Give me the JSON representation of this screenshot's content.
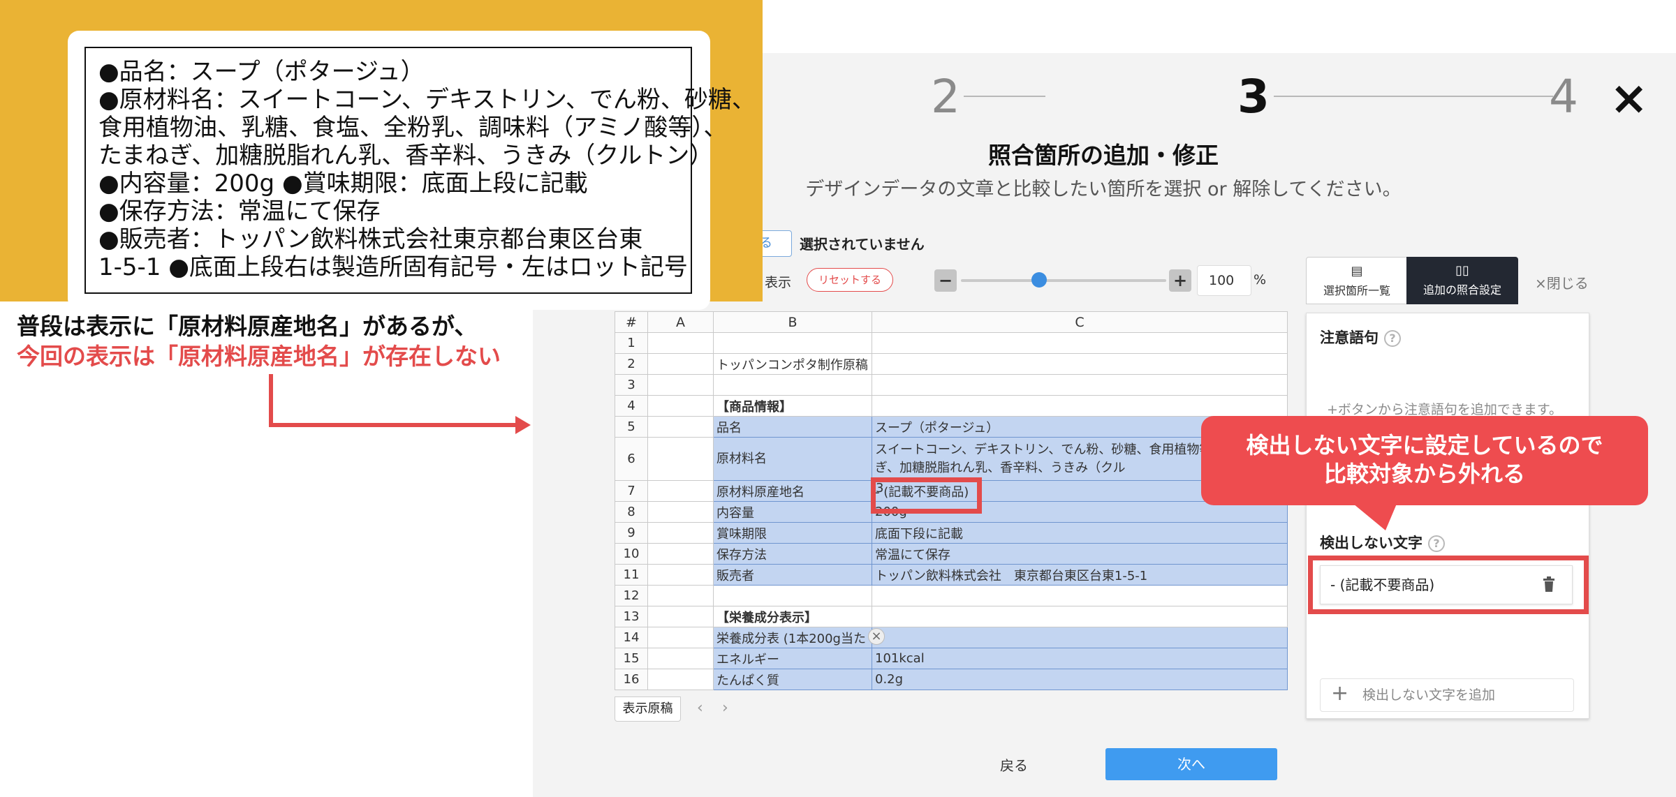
{
  "stepper": {
    "step2": "2",
    "step3": "3",
    "step4": "4",
    "close": "×"
  },
  "modal": {
    "title": "照合箇所の追加・修正",
    "subtitle": "デザインデータの文章と比較したい箇所を選択 or 解除してください。"
  },
  "toolbar": {
    "partial_button": "る",
    "selection_status": "選択されていません",
    "view_label": "表示",
    "reset_button": "リセットする",
    "zoom_minus": "−",
    "zoom_plus": "+",
    "zoom_value": "100",
    "zoom_unit": "%",
    "zoom_level": 0.38
  },
  "sheet": {
    "headers": [
      "#",
      "A",
      "B",
      "C"
    ],
    "rows": [
      {
        "n": "1",
        "b": "",
        "c": ""
      },
      {
        "n": "2",
        "b": "トッパンコンポタ制作原稿",
        "c": ""
      },
      {
        "n": "3",
        "b": "",
        "c": ""
      },
      {
        "n": "4",
        "b": "【商品情報】",
        "c": ""
      },
      {
        "n": "5",
        "b": "品名",
        "c": "スープ（ポタージュ）"
      },
      {
        "n": "6",
        "b": "原材料名",
        "c": "スイートコーン、デキストリン、でん粉、砂糖、食用植物等）、たまねぎ、加糖脱脂れん乳、香辛料、うきみ（クル"
      },
      {
        "n": "7",
        "b": "原材料原産地名",
        "c": "- (記載不要商品)"
      },
      {
        "n": "8",
        "b": "内容量",
        "c": "200g"
      },
      {
        "n": "9",
        "b": "賞味期限",
        "c": "底面下段に記載"
      },
      {
        "n": "10",
        "b": "保存方法",
        "c": "常温にて保存"
      },
      {
        "n": "11",
        "b": "販売者",
        "c": "トッパン飲料株式会社　東京都台東区台東1-5-1"
      },
      {
        "n": "12",
        "b": "",
        "c": ""
      },
      {
        "n": "13",
        "b": "【栄養成分表示】",
        "c": ""
      },
      {
        "n": "14",
        "b": "栄養成分表 (1本200g当た",
        "c": ")"
      },
      {
        "n": "15",
        "b": "エネルギー",
        "c": "101kcal"
      },
      {
        "n": "16",
        "b": "たんぱく質",
        "c": "0.2g"
      }
    ],
    "sheet_tab": "表示原稿",
    "prev": "‹",
    "next": "›",
    "cell_close": "×"
  },
  "panel": {
    "tab_list": "選択箇所一覧",
    "tab_add": "追加の照合設定",
    "close": "×閉じる",
    "caution_title": "注意語句",
    "help": "?",
    "caution_hint": "+ボタンから注意語句を追加できます。",
    "exclude_title": "検出しない文字",
    "exclude_item": "- (記載不要商品)",
    "add_exclude": "検出しない文字を追加",
    "add_plus": "+"
  },
  "footer": {
    "back": "戻る",
    "next": "次へ"
  },
  "label_image": {
    "lines": [
      "●品名：スープ（ポタージュ）",
      "●原材料名：スイートコーン、デキストリン、でん粉、砂糖、",
      "食用植物油、乳糖、食塩、全粉乳、調味料（アミノ酸等）、",
      "たまねぎ、加糖脱脂れん乳、香辛料、うきみ（クルトン）",
      "●内容量：200g ●賞味期限：底面上段に記載",
      "●保存方法：常温にて保存",
      "●販売者：トッパン飲料株式会社東京都台東区台東",
      "1-5-1 ●底面上段右は製造所固有記号・左はロット記号"
    ]
  },
  "annotations": {
    "note_line1": "普段は表示に「原材料原産地名」があるが、",
    "note_line2": "今回の表示は「原材料原産地名」が存在しない",
    "callout_line1": "検出しない文字に設定しているので",
    "callout_line2": "比較対象から外れる",
    "cursor_mark": "3"
  },
  "colors": {
    "accent_red": "#e34b4b",
    "accent_blue": "#3f9bf0",
    "highlight": "#c3d5f1",
    "dark_tab": "#232832",
    "label_background": "#eab334"
  }
}
